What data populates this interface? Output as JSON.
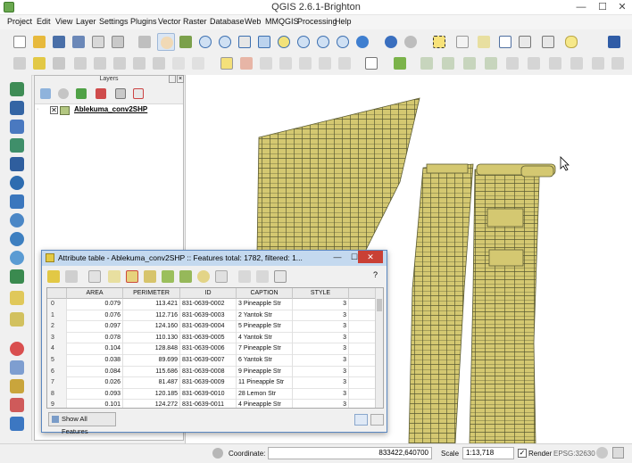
{
  "window": {
    "title": "QGIS 2.6.1-Brighton",
    "controls": [
      "—",
      "☐",
      "✕"
    ]
  },
  "menu": [
    "Project",
    "Edit",
    "View",
    "Layer",
    "Settings",
    "Plugins",
    "Vector",
    "Raster",
    "Database",
    "Web",
    "MMQGIS",
    "Processing",
    "Help"
  ],
  "layers_panel": {
    "title": "Layers",
    "layer_name": "Ablekuma_conv2SHP",
    "layer_checked": "✕"
  },
  "attribute_table": {
    "title": "Attribute table - Ablekuma_conv2SHP :: Features total: 1782, filtered: 1...",
    "help": "?",
    "columns": [
      "AREA",
      "PERIMETER",
      "ID",
      "CAPTION",
      "STYLE"
    ],
    "rows": [
      {
        "rid": "0",
        "area": "0.079",
        "perimeter": "113.421",
        "id": "831-0639-0002",
        "caption": "3 Pineapple Str",
        "style": "3"
      },
      {
        "rid": "1",
        "area": "0.076",
        "perimeter": "112.716",
        "id": "831-0639-0003",
        "caption": "2 Yantok Str",
        "style": "3"
      },
      {
        "rid": "2",
        "area": "0.097",
        "perimeter": "124.160",
        "id": "831-0639-0004",
        "caption": "5 Pineapple Str",
        "style": "3"
      },
      {
        "rid": "3",
        "area": "0.078",
        "perimeter": "110.130",
        "id": "831-0639-0005",
        "caption": "4 Yantok Str",
        "style": "3"
      },
      {
        "rid": "4",
        "area": "0.104",
        "perimeter": "128.848",
        "id": "831-0639-0006",
        "caption": "7 Pineapple Str",
        "style": "3"
      },
      {
        "rid": "5",
        "area": "0.038",
        "perimeter": "89.699",
        "id": "831-0639-0007",
        "caption": "6 Yantok Str",
        "style": "3"
      },
      {
        "rid": "6",
        "area": "0.084",
        "perimeter": "115.686",
        "id": "831-0639-0008",
        "caption": "9 Pineapple Str",
        "style": "3"
      },
      {
        "rid": "7",
        "area": "0.026",
        "perimeter": "81.487",
        "id": "831-0639-0009",
        "caption": "11 Pineapple Str",
        "style": "3"
      },
      {
        "rid": "8",
        "area": "0.093",
        "perimeter": "120.185",
        "id": "831-0639-0010",
        "caption": "28 Lemon Str",
        "style": "3"
      },
      {
        "rid": "9",
        "area": "0.101",
        "perimeter": "124.272",
        "id": "831-0639-0011",
        "caption": "4 Pineapple Str",
        "style": "3"
      }
    ],
    "show_all_label": "Show All Features"
  },
  "statusbar": {
    "coordinate_label": "Coordinate:",
    "coordinate_value": "833422,640700",
    "scale_label": "Scale",
    "scale_value": "1:13,718",
    "render_label": "Render",
    "render_checked": "✓",
    "crs": "EPSG:32630"
  },
  "colors": {
    "parcel_fill": "#d4c871",
    "parcel_stroke": "#5b5b32",
    "selection_titlebar": "#c4d9ef",
    "layer_swatch": "#b3c781"
  }
}
